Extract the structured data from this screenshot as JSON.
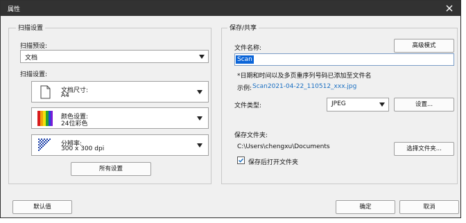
{
  "window": {
    "title": "属性"
  },
  "scan_settings": {
    "group_title": "扫描设置",
    "preset_label": "扫描预设:",
    "preset_value": "文档",
    "settings_label": "扫描设置:",
    "doc_size": {
      "label": "文档尺寸:",
      "value": "A4"
    },
    "color": {
      "label": "颜色设置:",
      "value": "24位彩色"
    },
    "resolution": {
      "label": "分辨率:",
      "value": "300 x 300 dpi"
    },
    "all_settings_button": "所有设置"
  },
  "save_share": {
    "group_title": "保存/共享",
    "filename_label": "文件名称:",
    "advanced_button": "高级模式",
    "filename_value": "Scan",
    "note": "*日期和时间以及多页重序列号码已添加至文件名",
    "example_label": "示例:",
    "example_value": "Scan2021-04-22_110512_xxx.jpg",
    "filetype_label": "文件类型:",
    "filetype_value": "JPEG",
    "settings_button": "设置...",
    "folder_label": "保存文件夹:",
    "folder_path": "C:\\Users\\chengxu\\Documents",
    "choose_folder_button": "选择文件夹...",
    "open_after_save_label": "保存后打开文件夹",
    "open_after_save_checked": true
  },
  "footer": {
    "default_button": "默认值",
    "ok_button": "确定",
    "cancel_button": "取消"
  },
  "colors": {
    "titlebar": "#323232",
    "selection": "#0a64d8",
    "link": "#1a6fc2"
  }
}
